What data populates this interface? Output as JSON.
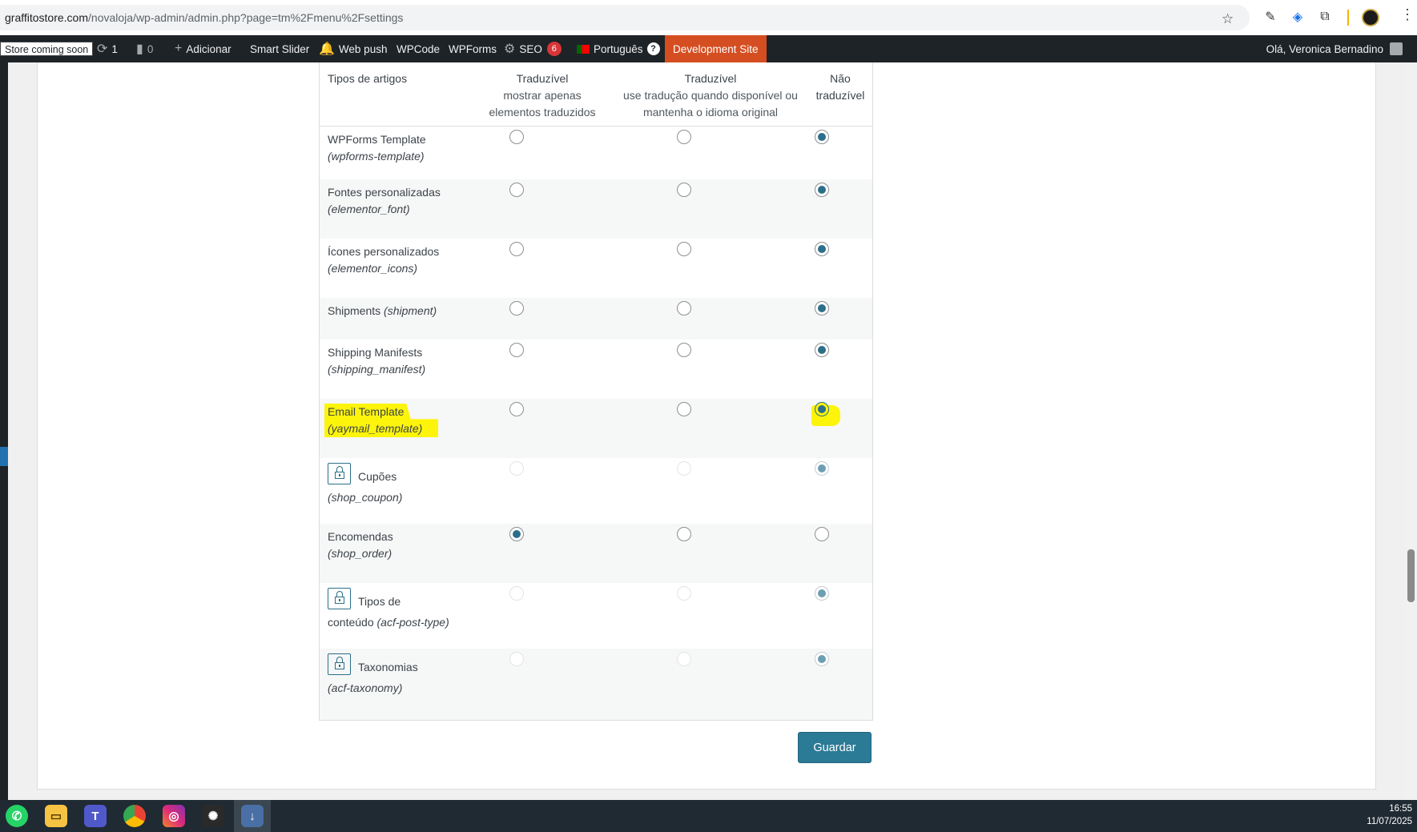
{
  "browser": {
    "url_host": "graffitostore.com",
    "url_path": "/novaloja/wp-admin/admin.php?page=tm%2Fmenu%2Fsettings",
    "icons": [
      "star-icon",
      "eyedropper-icon",
      "tag-extension-icon",
      "puzzle-extensions-icon",
      "profile-avatar",
      "more-menu-icon"
    ]
  },
  "adminbar": {
    "store_badge": "Store coming soon",
    "updates_count": "1",
    "comments_count": "0",
    "new_label": "Adicionar",
    "smart_slider": "Smart Slider",
    "web_push": "Web push",
    "wpcode": "WPCode",
    "wpforms": "WPForms",
    "seo": "SEO",
    "seo_count": "6",
    "language": "Português",
    "language_badge": "?",
    "dev_site": "Development Site",
    "greeting": "Olá, Veronica Bernadino"
  },
  "table": {
    "header": {
      "col1": "Tipos de artigos",
      "col2_title": "Traduzível",
      "col2_sub1": "mostrar apenas",
      "col2_sub2": "elementos traduzidos",
      "col3_title": "Traduzível",
      "col3_sub1": "use tradução quando disponível ou",
      "col3_sub2": "mantenha o idioma original",
      "col4_line1": "Não",
      "col4_line2": "traduzível"
    },
    "rows": [
      {
        "name": "WPForms Template",
        "slug": "(wpforms-template)",
        "selected": 3,
        "locked": false
      },
      {
        "name": "Fontes personalizadas",
        "slug": "(elementor_font)",
        "selected": 3,
        "locked": false
      },
      {
        "name": "Ícones personalizados",
        "slug": "(elementor_icons)",
        "selected": 3,
        "locked": false
      },
      {
        "name": "Shipments",
        "slug": "(shipment)",
        "selected": 3,
        "locked": false
      },
      {
        "name": "Shipping Manifests",
        "slug": "(shipping_manifest)",
        "selected": 3,
        "locked": false
      },
      {
        "name": "Email Template",
        "slug": "(yaymail_template)",
        "selected": 3,
        "locked": false,
        "highlighted": true
      },
      {
        "name": "Cupões",
        "slug": "(shop_coupon)",
        "selected": 3,
        "locked": true
      },
      {
        "name": "Encomendas",
        "slug": "(shop_order)",
        "selected": 1,
        "locked": false
      },
      {
        "name": "Tipos de",
        "name2": "conteúdo",
        "slug": "(acf-post-type)",
        "selected": 3,
        "locked": true
      },
      {
        "name": "Taxonomias",
        "slug": "(acf-taxonomy)",
        "selected": 3,
        "locked": true
      }
    ]
  },
  "save_label": "Guardar",
  "taskbar": {
    "time": "16:55",
    "date": "11/07/2025",
    "apps": [
      "whatsapp-icon",
      "file-explorer-icon",
      "teams-icon",
      "chrome-icon",
      "instagram-icon",
      "chatgpt-icon",
      "active-app-icon"
    ]
  },
  "colors": {
    "adminbar_bg": "#1d2327",
    "dev_site_bg": "#d54e21",
    "radio_checked": "#2c6f8a",
    "save_button": "#2b7a96",
    "highlight": "#fcf40a"
  }
}
